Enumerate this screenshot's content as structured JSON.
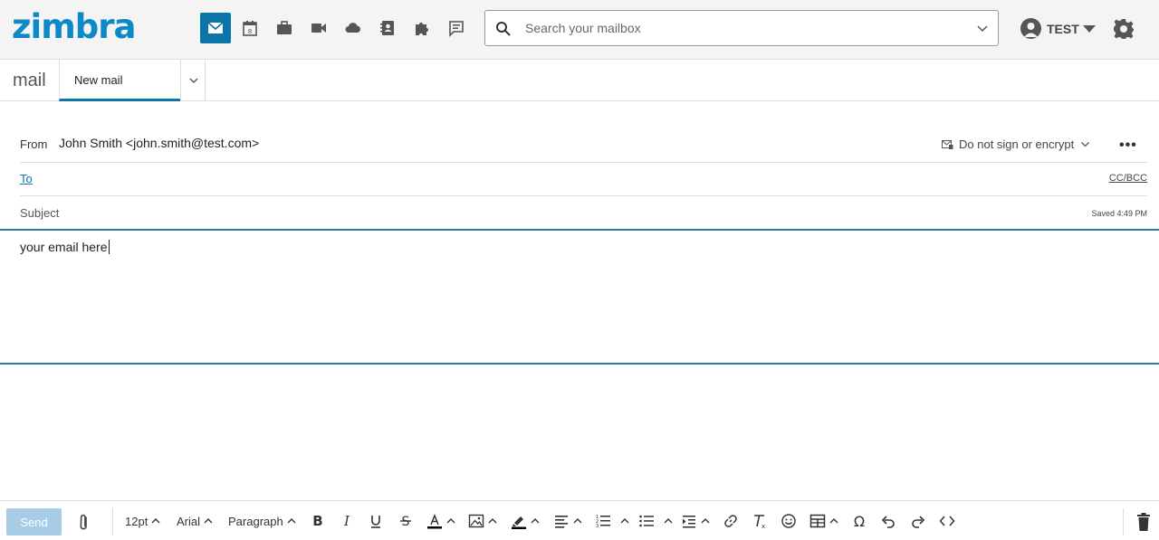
{
  "header": {
    "logo": "zimbra",
    "apps": [
      {
        "name": "mail-icon",
        "active": true
      },
      {
        "name": "calendar-icon",
        "active": false
      },
      {
        "name": "briefcase-icon",
        "active": false
      },
      {
        "name": "video-icon",
        "active": false
      },
      {
        "name": "cloud-icon",
        "active": false
      },
      {
        "name": "contacts-icon",
        "active": false
      },
      {
        "name": "puzzle-icon",
        "active": false
      },
      {
        "name": "chat-icon",
        "active": false
      }
    ],
    "search_placeholder": "Search your mailbox",
    "user_name": "TEST"
  },
  "tabs": {
    "section": "mail",
    "active_tab": "New mail"
  },
  "compose": {
    "from_label": "From",
    "from_value": "John Smith <john.smith@test.com>",
    "sign_option": "Do not sign or encrypt",
    "more": "•••",
    "to_label": "To",
    "cc_bcc": "CC/BCC",
    "subject_label": "Subject",
    "saved_status": "Saved 4:49 PM",
    "body": "your email here"
  },
  "toolbar": {
    "send_label": "Send",
    "font_size": "12pt",
    "font_family": "Arial",
    "block_format": "Paragraph"
  },
  "colors": {
    "brand": "#0c89c6",
    "accent": "#0b75a8",
    "send_disabled": "#a7cde6"
  }
}
